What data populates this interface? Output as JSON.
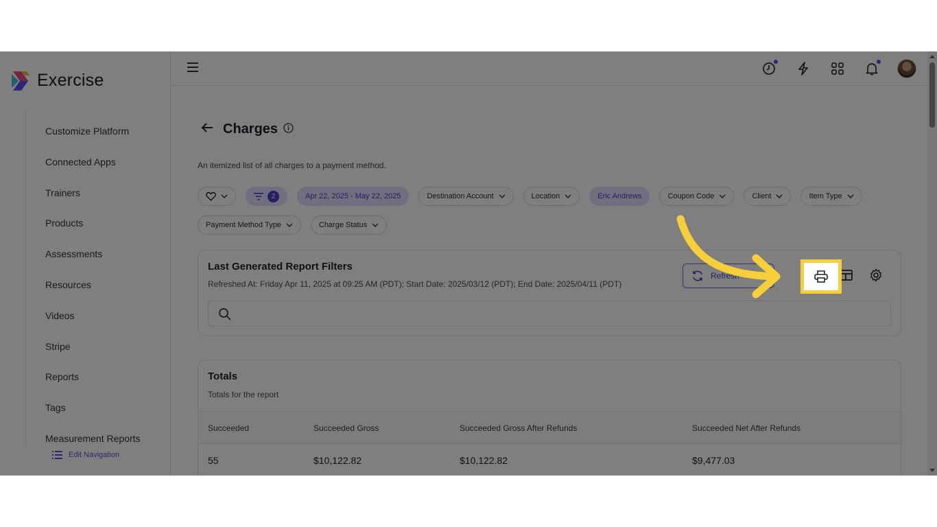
{
  "app": {
    "name": "Exercise"
  },
  "sidebar": {
    "items": [
      {
        "label": "Customize Platform"
      },
      {
        "label": "Connected Apps"
      },
      {
        "label": "Trainers"
      },
      {
        "label": "Products"
      },
      {
        "label": "Assessments"
      },
      {
        "label": "Resources"
      },
      {
        "label": "Videos"
      },
      {
        "label": "Stripe"
      },
      {
        "label": "Reports"
      },
      {
        "label": "Tags"
      },
      {
        "label": "Measurement Reports"
      }
    ],
    "edit_nav_label": "Edit Navigation"
  },
  "topbar": {
    "icons": [
      "menu-icon",
      "history-icon",
      "bolt-icon",
      "apps-grid-icon",
      "bell-icon",
      "avatar"
    ],
    "notification_dot_color": "#5a4ff3"
  },
  "page": {
    "title": "Charges",
    "subtitle": "An itemized list of all charges to a payment method."
  },
  "filters": {
    "filter_count": "2",
    "date_range": "Apr 22, 2025 - May 22, 2025",
    "destination_account": "Destination Account",
    "location": "Location",
    "trainer": "Eric Andrews",
    "coupon_code": "Coupon Code",
    "client": "Client",
    "item_type": "Item Type",
    "payment_method_type": "Payment Method Type",
    "charge_status": "Charge Status"
  },
  "report_card": {
    "title": "Last Generated Report Filters",
    "refreshed_text": "Refreshed At: Friday Apr 11, 2025 at 09:25 AM (PDT); Start Date: 2025/03/12 (PDT); End Date: 2025/04/11 (PDT)",
    "refresh_label": "Refresh",
    "search_placeholder": ""
  },
  "totals": {
    "title": "Totals",
    "subtitle": "Totals for the report",
    "columns": [
      "Succeeded",
      "Succeeded Gross",
      "Succeeded Gross After Refunds",
      "Succeeded Net After Refunds"
    ],
    "row": [
      "55",
      "$10,122.82",
      "$10,122.82",
      "$9,477.03"
    ]
  },
  "colors": {
    "accent": "#4b3fc0",
    "chip_purple_bg": "#e3ddff",
    "highlight": "#f7cf3a"
  }
}
